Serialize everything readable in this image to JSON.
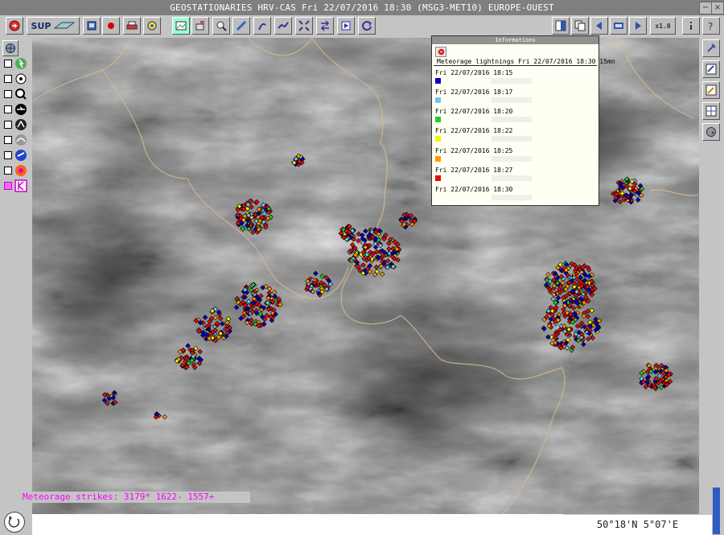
{
  "window": {
    "title": "GEOSTATIONARIES HRV-CAS Fri 22/07/2016 18:30 (MSG3-MET10) EUROPE-OUEST",
    "minimize_glyph": "−",
    "close_glyph": "×"
  },
  "toolbar": {
    "sup_label": "SUP",
    "zoom_label": "x1.0"
  },
  "info_panel": {
    "header": "Informations",
    "title": "Meteorage lightnings Fri 22/07/2016 18:30 15mn",
    "entries": [
      {
        "time": "Fri 22/07/2016 18:15",
        "color": "#0000c8"
      },
      {
        "time": "Fri 22/07/2016 18:17",
        "color": "#70c8f0"
      },
      {
        "time": "Fri 22/07/2016 18:20",
        "color": "#22cc22"
      },
      {
        "time": "Fri 22/07/2016 18:22",
        "color": "#f5f500"
      },
      {
        "time": "Fri 22/07/2016 18:25",
        "color": "#ff9a00"
      },
      {
        "time": "Fri 22/07/2016 18:27",
        "color": "#e01010"
      },
      {
        "time": "Fri 22/07/2016 18:30",
        "color": "#f0f0e8"
      }
    ]
  },
  "status": {
    "strikes": "Meteorage strikes:  3179*  1622-  1557+",
    "coords": "50°18'N 5°07'E"
  },
  "colors": {
    "accent": "#ff00ff",
    "scroll": "#2d5cc4"
  }
}
